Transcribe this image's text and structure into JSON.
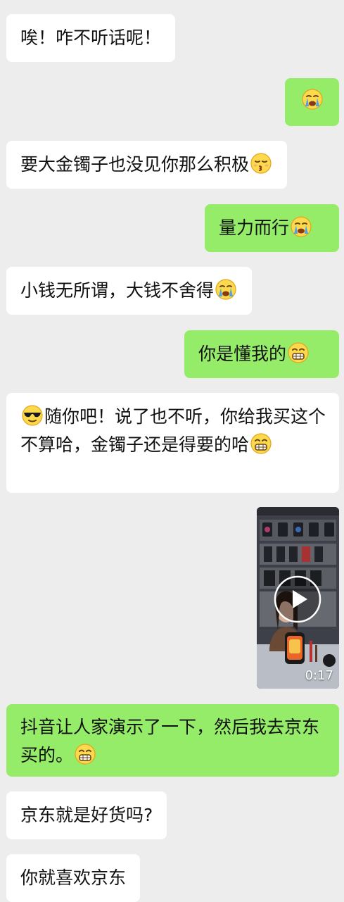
{
  "messages": [
    {
      "text": "唉！咋不听话呢！"
    },
    {
      "text": ""
    },
    {
      "text": "要大金镯子也没见你那么积极"
    },
    {
      "text": "量力而行"
    },
    {
      "text": "小钱无所谓，大钱不舍得"
    },
    {
      "text": "你是懂我的"
    },
    {
      "text": "随你吧！说了也不听，你给我买这个不算哈，金镯子还是得要的哈"
    },
    {
      "duration": "0:17"
    },
    {
      "text": "抖音让人家演示了一下，然后我去京东买的。"
    },
    {
      "text": "京东就是好货吗?"
    },
    {
      "text": "你就喜欢京东"
    }
  ],
  "icons": {
    "sob": "loudly-crying-face-icon",
    "kiss": "kissing-face-icon",
    "cool": "sunglasses-face-icon",
    "grin": "grinning-face-icon",
    "play": "play-icon"
  },
  "colors": {
    "chat_background": "#ededed",
    "incoming_bubble": "#ffffff",
    "outgoing_bubble": "#95ec69",
    "text": "#111111"
  }
}
